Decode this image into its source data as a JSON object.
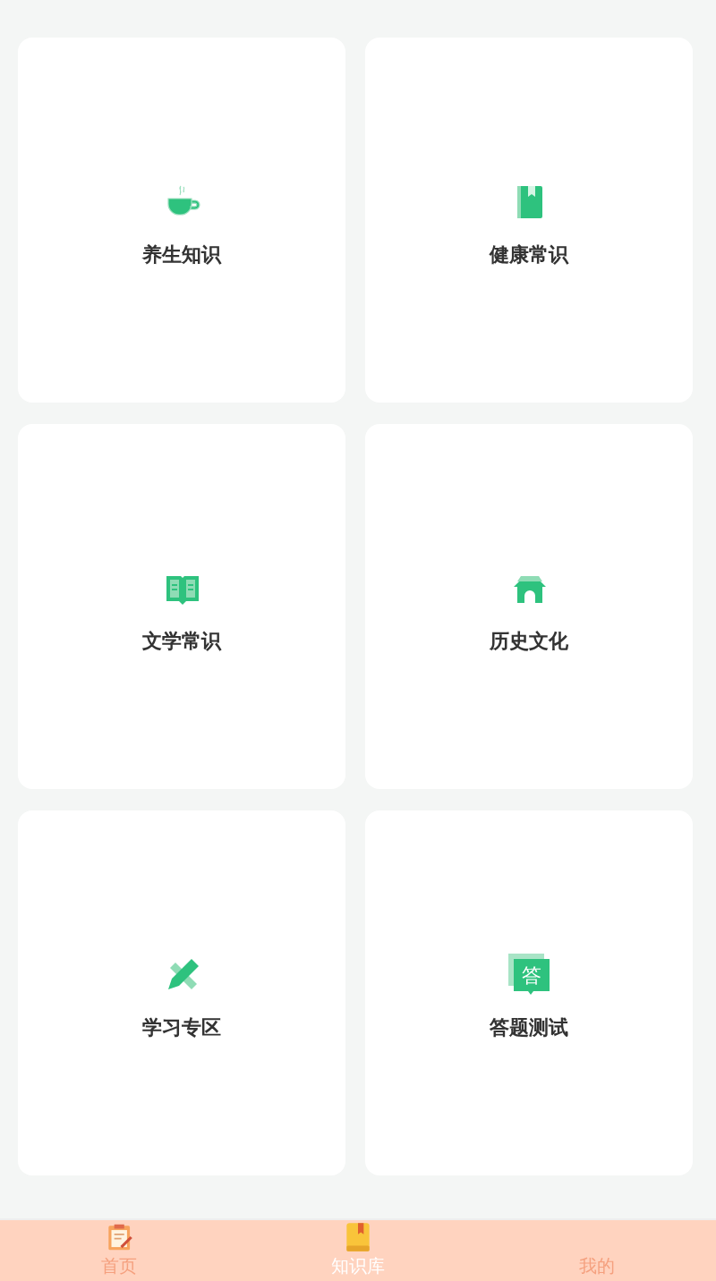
{
  "categories": [
    {
      "label": "养生知识",
      "kind": "cup"
    },
    {
      "label": "健康常识",
      "kind": "book"
    },
    {
      "label": "文学常识",
      "kind": "reading"
    },
    {
      "label": "历史文化",
      "kind": "gate"
    },
    {
      "label": "学习专区",
      "kind": "pencil"
    },
    {
      "label": "答题测试",
      "kind": "quiz"
    }
  ],
  "quiz_icon_text": "答",
  "tab_bar": [
    {
      "label": "首页",
      "kind": "home",
      "selected": false
    },
    {
      "label": "知识库",
      "kind": "library",
      "selected": true
    },
    {
      "label": "我的",
      "kind": "mine",
      "selected": false
    }
  ]
}
